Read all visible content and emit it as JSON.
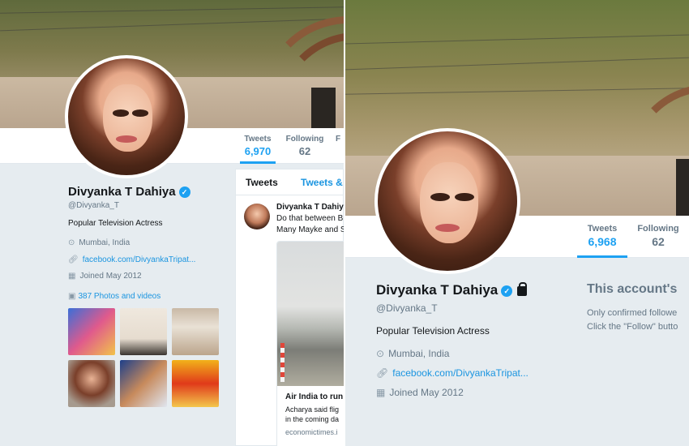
{
  "colors": {
    "accent": "#1da1f2",
    "link": "#1b95e0",
    "muted": "#657786"
  },
  "left": {
    "stats": [
      {
        "label": "Tweets",
        "value": "6,970"
      },
      {
        "label": "Following",
        "value": "62"
      },
      {
        "label": "F"
      }
    ],
    "profile": {
      "name": "Divyanka T Dahiya",
      "handle": "@Divyanka_T",
      "bio": "Popular Television Actress",
      "location": "Mumbai, India",
      "website": "facebook.com/DivyankaTripat...",
      "joined": "Joined May 2012",
      "photos_link": "387 Photos and videos"
    },
    "tabs": [
      "Tweets",
      "Tweets &"
    ],
    "tweet": {
      "author": "Divyanka T Dahiya",
      "lines": [
        "Do that between B",
        "Many Mayke and S"
      ],
      "card_title": "Air India to run",
      "card_lines": [
        "Acharya said flig",
        "in the coming da"
      ],
      "card_source": "economictimes.i"
    }
  },
  "right": {
    "stats": [
      {
        "label": "Tweets",
        "value": "6,968"
      },
      {
        "label": "Following",
        "value": "62"
      }
    ],
    "profile": {
      "name": "Divyanka T Dahiya",
      "handle": "@Divyanka_T",
      "bio": "Popular Television Actress",
      "location": "Mumbai, India",
      "website": "facebook.com/DivyankaTripat...",
      "joined": "Joined May 2012"
    },
    "protected": {
      "title": "This account's",
      "line1": "Only confirmed followe",
      "line2": "Click the \"Follow\" butto"
    }
  },
  "icons": {
    "verified": "verified-badge-icon",
    "lock": "lock-icon",
    "location": "map-pin-icon",
    "link": "link-icon",
    "calendar": "calendar-icon",
    "photos": "image-icon"
  }
}
